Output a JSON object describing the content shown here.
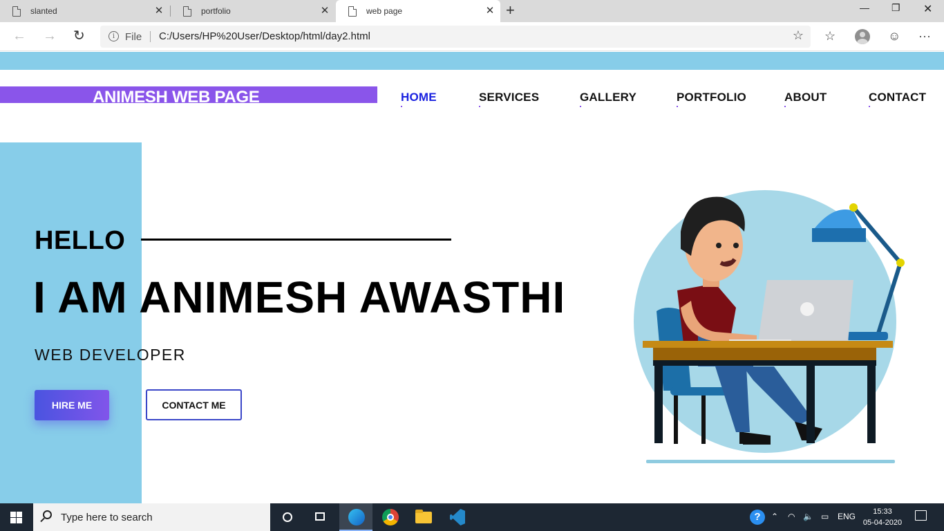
{
  "browser": {
    "tabs": [
      {
        "title": "slanted"
      },
      {
        "title": "portfolio"
      },
      {
        "title": "web page"
      }
    ],
    "address": {
      "scheme_label": "File",
      "url": "C:/Users/HP%20User/Desktop/html/day2.html"
    }
  },
  "page": {
    "brand": "ANIMESH WEB PAGE",
    "nav": [
      "HOME",
      "SERVICES",
      "GALLERY",
      "PORTFOLIO",
      "ABOUT",
      "CONTACT"
    ],
    "hero": {
      "greeting": "HELLO",
      "headline": "I AM ANIMESH AWASTHI",
      "role": "WEB DEVELOPER",
      "hire_button": "HIRE ME",
      "contact_button": "CONTACT ME"
    },
    "colors": {
      "accent_blue": "#87cde9",
      "brand_purple": "#8a55ea",
      "active_nav": "#1a22e0"
    }
  },
  "taskbar": {
    "search_placeholder": "Type here to search",
    "language": "ENG",
    "time": "15:33",
    "date": "05-04-2020"
  }
}
